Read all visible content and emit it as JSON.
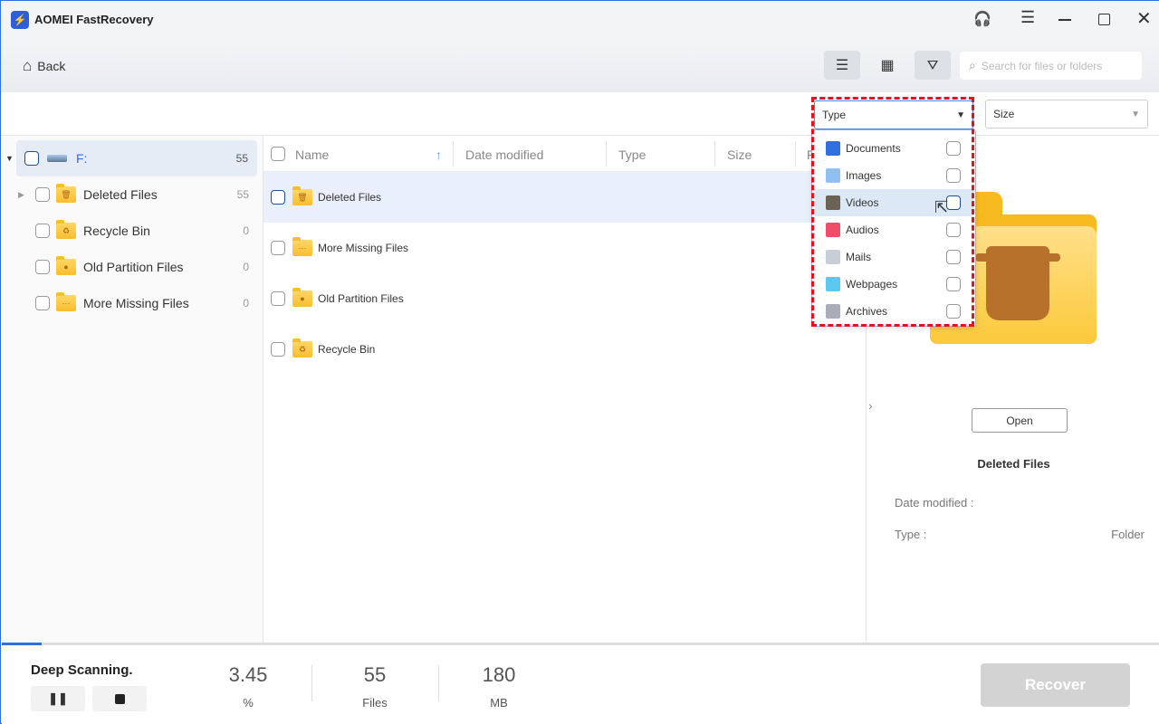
{
  "app": {
    "title": "AOMEI FastRecovery"
  },
  "toolbar": {
    "back_label": "Back",
    "search_placeholder": "Search for files or folders"
  },
  "filters": {
    "type_label": "Type",
    "size_label": "Size",
    "type_options": [
      {
        "label": "Documents",
        "icon": "word-doc-icon",
        "color": "#2f6fe0"
      },
      {
        "label": "Images",
        "icon": "image-icon",
        "color": "#8ec0f5"
      },
      {
        "label": "Videos",
        "icon": "video-icon",
        "color": "#6b6155"
      },
      {
        "label": "Audios",
        "icon": "music-icon",
        "color": "#ef4d6a"
      },
      {
        "label": "Mails",
        "icon": "mail-icon",
        "color": "#c8ced6"
      },
      {
        "label": "Webpages",
        "icon": "webpage-icon",
        "color": "#5bc8ef"
      },
      {
        "label": "Archives",
        "icon": "archive-icon",
        "color": "#a8adba"
      }
    ],
    "hovered": "Videos"
  },
  "sidebar": {
    "drive": {
      "label": "F:",
      "count": "55"
    },
    "items": [
      {
        "label": "Deleted Files",
        "count": "55",
        "glyph": "🗑"
      },
      {
        "label": "Recycle Bin",
        "count": "0",
        "glyph": "♻"
      },
      {
        "label": "Old Partition Files",
        "count": "0",
        "glyph": "●"
      },
      {
        "label": "More Missing Files",
        "count": "0",
        "glyph": "···"
      }
    ]
  },
  "columns": {
    "name": "Name",
    "date": "Date modified",
    "type": "Type",
    "size": "Size",
    "path": "P"
  },
  "files": [
    {
      "name": "Deleted Files",
      "glyph": "🗑"
    },
    {
      "name": "More Missing Files",
      "glyph": "···"
    },
    {
      "name": "Old Partition Files",
      "glyph": "●"
    },
    {
      "name": "Recycle Bin",
      "glyph": "♻"
    }
  ],
  "detail": {
    "open_label": "Open",
    "name": "Deleted Files",
    "date_label": "Date modified :",
    "date_value": "",
    "type_label": "Type :",
    "type_value": "Folder"
  },
  "status": {
    "title": "Deep Scanning.",
    "progress_value": "3.45",
    "progress_unit": "%",
    "files_value": "55",
    "files_unit": "Files",
    "size_value": "180",
    "size_unit": "MB",
    "progress_fraction": 0.0345,
    "recover_label": "Recover"
  },
  "colors": {
    "accent": "#2f6fe0",
    "highlight": "#e9f0fb",
    "recover_disabled": "#d3d3d3"
  }
}
